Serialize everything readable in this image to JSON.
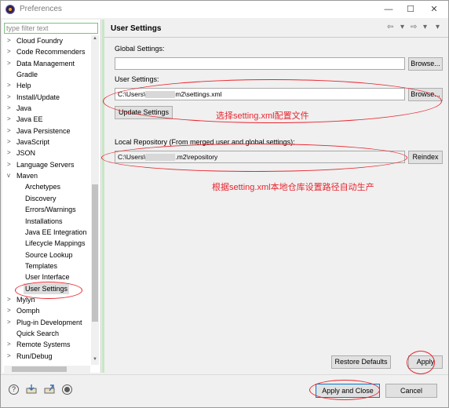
{
  "window": {
    "title": "Preferences",
    "minimize_glyph": "—",
    "maximize_glyph": "☐",
    "close_glyph": "✕"
  },
  "sidebar": {
    "filter_placeholder": "type filter text",
    "items": [
      {
        "label": "Cloud Foundry",
        "arrow": ">",
        "child": false
      },
      {
        "label": "Code Recommenders",
        "arrow": ">",
        "child": false
      },
      {
        "label": "Data Management",
        "arrow": ">",
        "child": false
      },
      {
        "label": "Gradle",
        "arrow": "",
        "child": false
      },
      {
        "label": "Help",
        "arrow": ">",
        "child": false
      },
      {
        "label": "Install/Update",
        "arrow": ">",
        "child": false
      },
      {
        "label": "Java",
        "arrow": ">",
        "child": false
      },
      {
        "label": "Java EE",
        "arrow": ">",
        "child": false
      },
      {
        "label": "Java Persistence",
        "arrow": ">",
        "child": false
      },
      {
        "label": "JavaScript",
        "arrow": ">",
        "child": false
      },
      {
        "label": "JSON",
        "arrow": ">",
        "child": false
      },
      {
        "label": "Language Servers",
        "arrow": ">",
        "child": false
      },
      {
        "label": "Maven",
        "arrow": "v",
        "child": false
      },
      {
        "label": "Archetypes",
        "arrow": "",
        "child": true
      },
      {
        "label": "Discovery",
        "arrow": "",
        "child": true
      },
      {
        "label": "Errors/Warnings",
        "arrow": "",
        "child": true
      },
      {
        "label": "Installations",
        "arrow": "",
        "child": true
      },
      {
        "label": "Java EE Integration",
        "arrow": "",
        "child": true
      },
      {
        "label": "Lifecycle Mappings",
        "arrow": "",
        "child": true
      },
      {
        "label": "Source Lookup",
        "arrow": "",
        "child": true
      },
      {
        "label": "Templates",
        "arrow": "",
        "child": true
      },
      {
        "label": "User Interface",
        "arrow": "",
        "child": true
      },
      {
        "label": "User Settings",
        "arrow": "",
        "child": true,
        "selected": true
      },
      {
        "label": "Mylyn",
        "arrow": ">",
        "child": false
      },
      {
        "label": "Oomph",
        "arrow": ">",
        "child": false
      },
      {
        "label": "Plug-in Development",
        "arrow": ">",
        "child": false
      },
      {
        "label": "Quick Search",
        "arrow": "",
        "child": false
      },
      {
        "label": "Remote Systems",
        "arrow": ">",
        "child": false
      },
      {
        "label": "Run/Debug",
        "arrow": ">",
        "child": false
      }
    ]
  },
  "main": {
    "title": "User Settings",
    "nav_back": "⇦",
    "nav_dropdown": "▾",
    "nav_forward": "⇨",
    "nav_menu": "▾",
    "global_settings_label": "Global Settings:",
    "global_settings_value": "",
    "browse_label": "Browse...",
    "user_settings_label": "User Settings:",
    "user_settings_prefix": "C:\\Users\\",
    "user_settings_suffix": "m2\\settings.xml",
    "update_settings_label": "Update Settings",
    "local_repo_label": "Local Repository (From merged user and global settings):",
    "local_repo_prefix": "C:\\Users\\",
    "local_repo_suffix": ".m2\\repository",
    "reindex_label": "Reindex",
    "annotation_1": "选择setting.xml配置文件",
    "annotation_2": "根据setting.xml本地仓库设置路径自动生产",
    "restore_defaults_label": "Restore Defaults",
    "apply_label": "Apply"
  },
  "footer": {
    "help_glyph": "?",
    "apply_close_label": "Apply and Close",
    "cancel_label": "Cancel"
  },
  "colors": {
    "annotation": "#e8262f",
    "sash": "#c8e6c8"
  }
}
